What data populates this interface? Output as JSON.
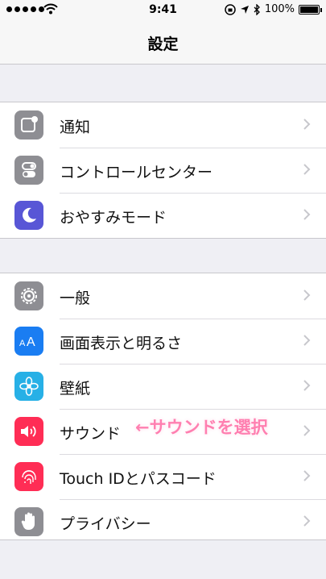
{
  "status_bar": {
    "time": "9:41",
    "battery": "100%"
  },
  "nav": {
    "title": "設定"
  },
  "groups": [
    {
      "items": [
        {
          "label": "通知",
          "icon": "notifications-icon",
          "color": "#8e8e93"
        },
        {
          "label": "コントロールセンター",
          "icon": "control-center-icon",
          "color": "#8e8e93"
        },
        {
          "label": "おやすみモード",
          "icon": "moon-icon",
          "color": "#5856d6"
        }
      ]
    },
    {
      "items": [
        {
          "label": "一般",
          "icon": "gear-icon",
          "color": "#8e8e93"
        },
        {
          "label": "画面表示と明るさ",
          "icon": "display-brightness-icon",
          "color": "#1a7df2"
        },
        {
          "label": "壁紙",
          "icon": "wallpaper-icon",
          "color": "#27b0e6"
        },
        {
          "label": "サウンド",
          "icon": "speaker-icon",
          "color": "#ff2d55"
        },
        {
          "label": "Touch IDとパスコード",
          "icon": "fingerprint-icon",
          "color": "#ff2d55"
        },
        {
          "label": "プライバシー",
          "icon": "hand-icon",
          "color": "#8e8e93"
        }
      ]
    }
  ],
  "annotation": {
    "text": "←サウンドを選択"
  }
}
